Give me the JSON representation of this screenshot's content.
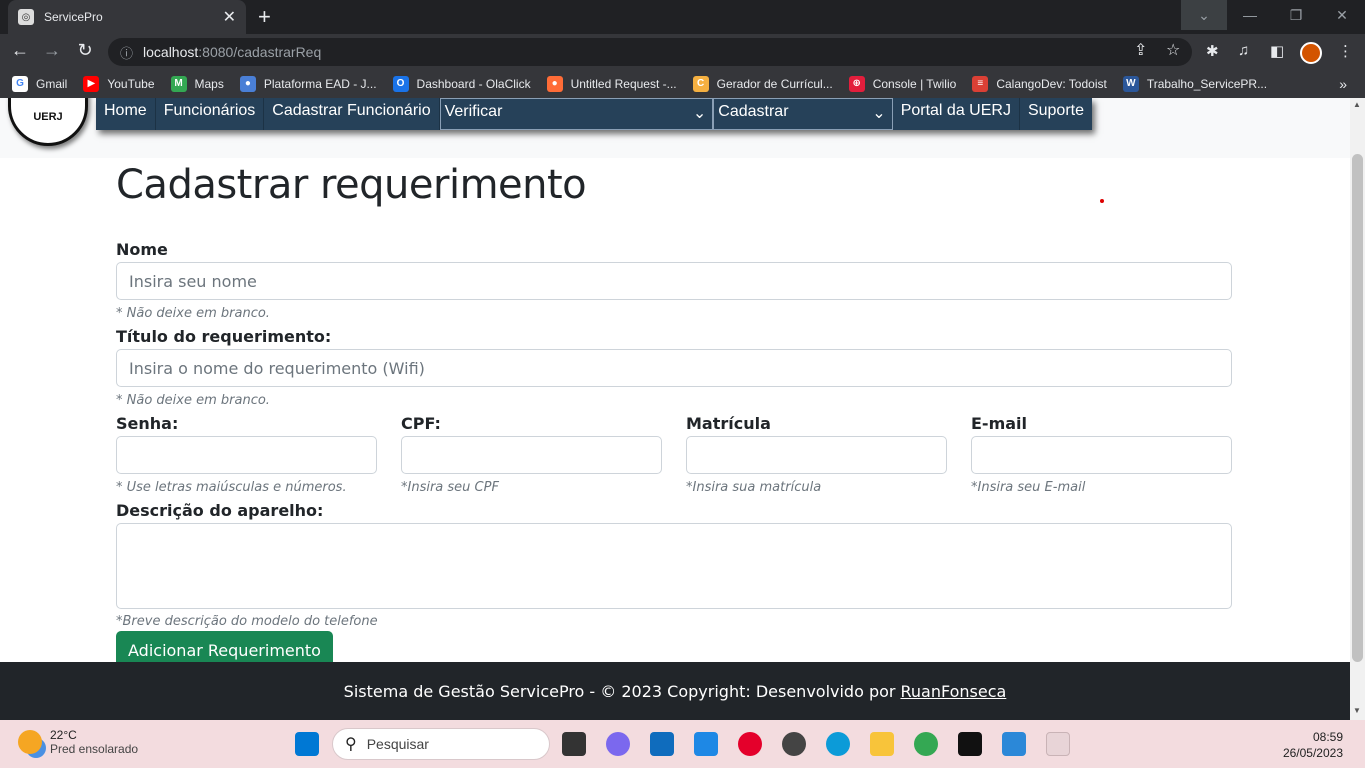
{
  "browser": {
    "tab_title": "ServicePro",
    "tab_close": "✕",
    "new_tab": "+",
    "url_host": "localhost",
    "url_path": ":8080/cadastrarReq",
    "bookmarks": [
      {
        "label": "Gmail",
        "color": "#ffffff",
        "glyph": "G"
      },
      {
        "label": "YouTube",
        "color": "#ff0000",
        "glyph": "▶"
      },
      {
        "label": "Maps",
        "color": "#34a853",
        "glyph": "M"
      },
      {
        "label": "Plataforma EAD - J...",
        "color": "#4a7fd6",
        "glyph": "●"
      },
      {
        "label": "Dashboard - OlaClick",
        "color": "#1a73e8",
        "glyph": "O"
      },
      {
        "label": "Untitled Request -...",
        "color": "#ff6c37",
        "glyph": "●"
      },
      {
        "label": "Gerador de Currícul...",
        "color": "#f5b041",
        "glyph": "C"
      },
      {
        "label": "Console | Twilio",
        "color": "#e31e3c",
        "glyph": "⊕"
      },
      {
        "label": "CalangoDev: Todoist",
        "color": "#db4035",
        "glyph": "≡"
      },
      {
        "label": "Trabalho_ServicePR...",
        "color": "#2b579a",
        "glyph": "W"
      }
    ],
    "bookmarks_more": "»"
  },
  "app": {
    "logo_text": "UERJ",
    "nav": {
      "home": "Home",
      "funcionarios": "Funcionários",
      "cadastrar_funcionario": "Cadastrar Funcionário",
      "verificar": "Verificar",
      "cadastrar": "Cadastrar",
      "portal": "Portal da UERJ",
      "suporte": "Suporte",
      "chevron": "⌄"
    },
    "page_title": "Cadastrar requerimento",
    "form": {
      "nome_label": "Nome",
      "nome_placeholder": "Insira seu nome",
      "nome_hint": "* Não deixe em branco.",
      "titulo_label": "Título do requerimento:",
      "titulo_placeholder": "Insira o nome do requerimento (Wifi)",
      "titulo_hint": "* Não deixe em branco.",
      "senha_label": "Senha:",
      "senha_hint": "* Use letras maiúsculas e números.",
      "cpf_label": "CPF:",
      "cpf_hint": "*Insira seu CPF",
      "matricula_label": "Matrícula",
      "matricula_hint": "*Insira sua matrícula",
      "email_label": "E-mail",
      "email_hint": "*Insira seu E-mail",
      "descricao_label": "Descrição do aparelho:",
      "descricao_hint": "*Breve descrição do modelo do telefone",
      "submit_label": "Adicionar Requerimento"
    },
    "footer": {
      "text": "Sistema de Gestão ServicePro - © 2023 Copyright: Desenvolvido por",
      "link": "RuanFonseca"
    }
  },
  "taskbar": {
    "temp": "22°C",
    "weather": "Pred ensolarado",
    "search": "Pesquisar",
    "time": "08:59",
    "date": "26/05/2023"
  }
}
